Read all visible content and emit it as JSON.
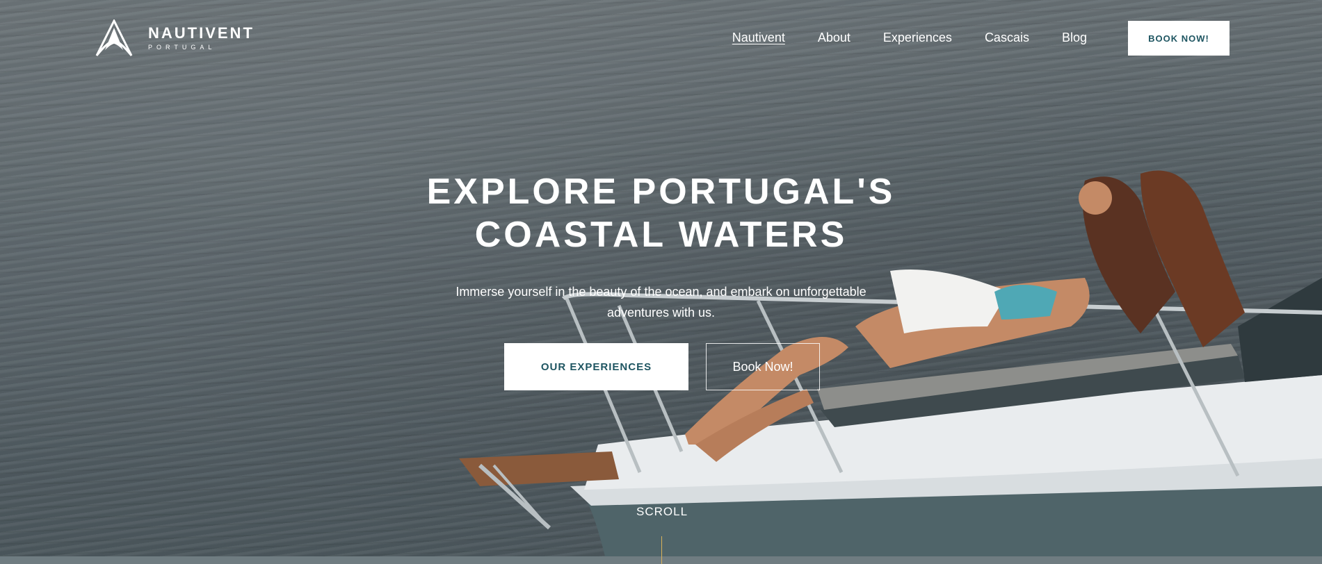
{
  "brand": {
    "name": "NAUTIVENT",
    "subtitle": "PORTUGAL"
  },
  "nav": {
    "items": [
      {
        "label": "Nautivent",
        "active": true
      },
      {
        "label": "About"
      },
      {
        "label": "Experiences"
      },
      {
        "label": "Cascais"
      },
      {
        "label": "Blog"
      }
    ],
    "book_label": "BOOK NOW!"
  },
  "hero": {
    "title_line1": "EXPLORE PORTUGAL'S",
    "title_line2": "COASTAL WATERS",
    "subtitle": "Immerse yourself in the beauty of the ocean, and embark on unforgettable adventures with us.",
    "primary_cta": "OUR EXPERIENCES",
    "secondary_cta": "Book Now!"
  },
  "scroll_label": "SCROLL",
  "colors": {
    "accent": "#1e5561",
    "scroll_line": "#d9b25a",
    "text": "#ffffff"
  },
  "icons": {
    "logo": "sail-mountain-logo"
  }
}
